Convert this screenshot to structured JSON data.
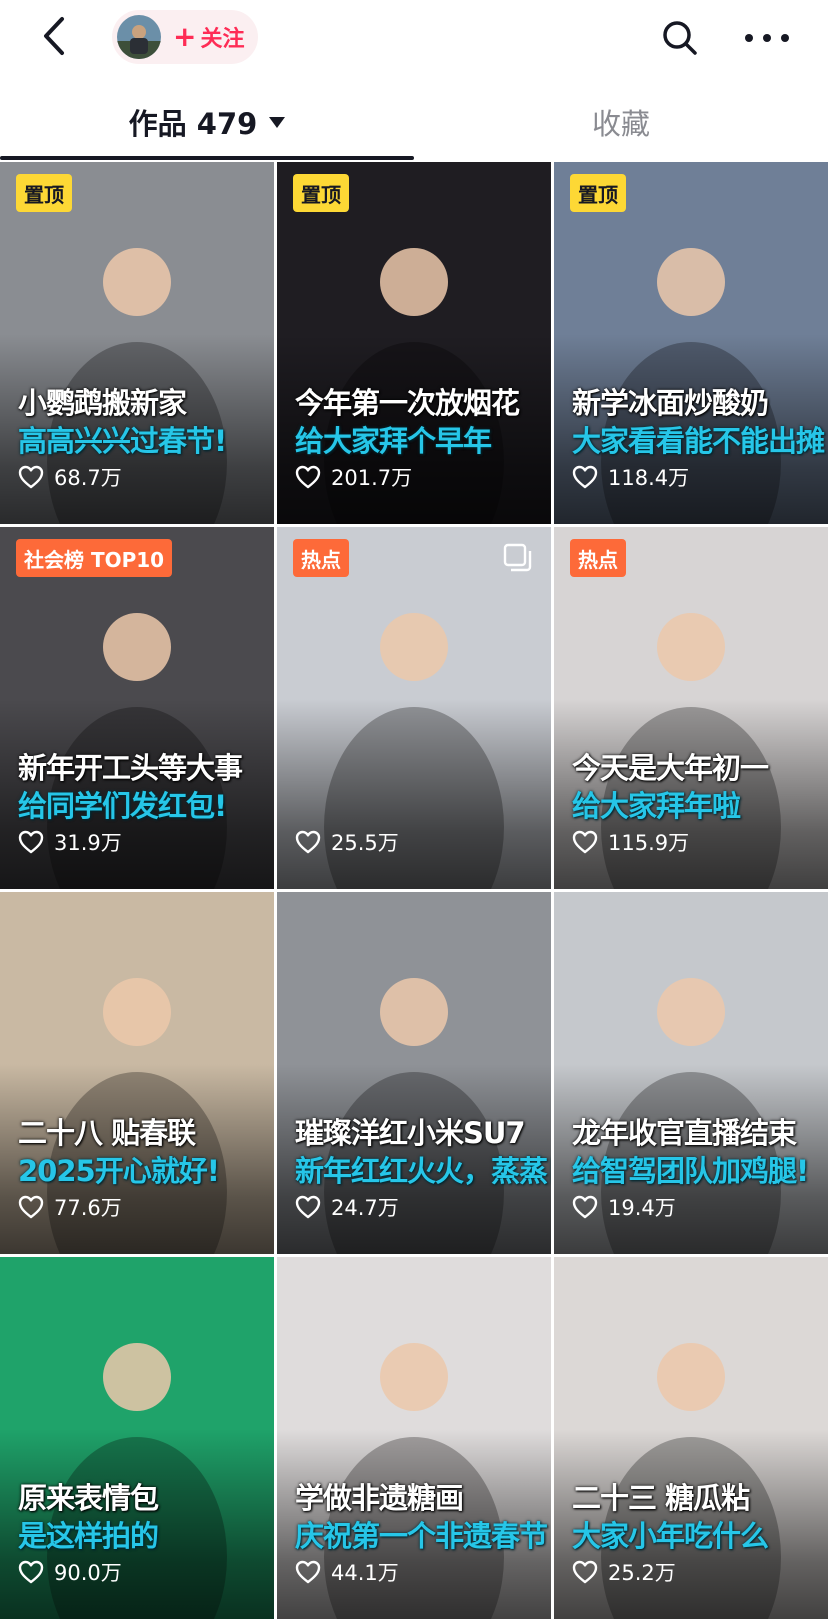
{
  "header": {
    "follow_plus": "+",
    "follow_label": "关注"
  },
  "tabs": {
    "works_label": "作品 479",
    "collect_label": "收藏"
  },
  "videos": [
    {
      "badge": "置顶",
      "badge_type": "pin",
      "line1": "小鹦鹉搬新家",
      "line2": "高高兴兴过春节!",
      "likes": "68.7万",
      "bg": "#8a8d92"
    },
    {
      "badge": "置顶",
      "badge_type": "pin",
      "line1": "今年第一次放烟花",
      "line2": "给大家拜个早年",
      "likes": "201.7万",
      "bg": "#1f1d22"
    },
    {
      "badge": "置顶",
      "badge_type": "pin",
      "line1": "新学冰面炒酸奶",
      "line2": "大家看看能不能出摊",
      "likes": "118.4万",
      "bg": "#6f7f97"
    },
    {
      "badge": "社会榜 TOP10",
      "badge_type": "hot",
      "line1": "新年开工头等大事",
      "line2": "给同学们发红包!",
      "likes": "31.9万",
      "bg": "#4b4a4e"
    },
    {
      "badge": "热点",
      "badge_type": "hot",
      "line1": "",
      "line2": "",
      "likes": "25.5万",
      "bg": "#c9ccd2",
      "multi": true
    },
    {
      "badge": "热点",
      "badge_type": "hot",
      "line1": "今天是大年初一",
      "line2": "给大家拜年啦",
      "likes": "115.9万",
      "bg": "#d7d4d4"
    },
    {
      "badge": "",
      "badge_type": "",
      "line1": "二十八 贴春联",
      "line2": "2025开心就好!",
      "likes": "77.6万",
      "bg": "#c9b9a3"
    },
    {
      "badge": "",
      "badge_type": "",
      "line1": "璀璨洋红小米SU7",
      "line2": "新年红红火火，蒸蒸日上!",
      "likes": "24.7万",
      "bg": "#8f9297"
    },
    {
      "badge": "",
      "badge_type": "",
      "line1": "龙年收官直播结束",
      "line2": "给智驾团队加鸡腿!",
      "likes": "19.4万",
      "bg": "#c5c8cc"
    },
    {
      "badge": "",
      "badge_type": "",
      "line1": "原来表情包",
      "line2": "是这样拍的",
      "likes": "90.0万",
      "bg": "#1fa36a"
    },
    {
      "badge": "",
      "badge_type": "",
      "line1": "学做非遗糖画",
      "line2": "庆祝第一个非遗春节",
      "likes": "44.1万",
      "bg": "#dfdcdc"
    },
    {
      "badge": "",
      "badge_type": "",
      "line1": "二十三 糖瓜粘",
      "line2": "大家小年吃什么",
      "likes": "25.2万",
      "bg": "#dcd8d6"
    }
  ]
}
